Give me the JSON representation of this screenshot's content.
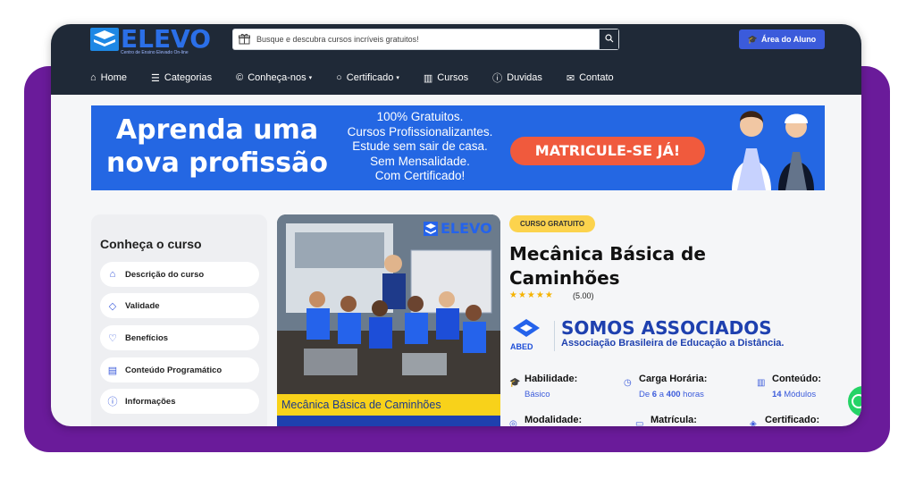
{
  "brand": {
    "name": "ELEVO",
    "tagline": "Centro de Ensino Elevado On-line"
  },
  "header": {
    "search_placeholder": "Busque e descubra cursos incríveis gratuitos!",
    "student_area_label": "Área do Aluno"
  },
  "nav": {
    "items": [
      {
        "label": "Home",
        "icon": "home-icon"
      },
      {
        "label": "Categorias",
        "icon": "menu-icon"
      },
      {
        "label": "Conheça-nos",
        "icon": "copyright-icon"
      },
      {
        "label": "Certificado",
        "icon": "circle-icon"
      },
      {
        "label": "Cursos",
        "icon": "books-icon"
      },
      {
        "label": "Duvidas",
        "icon": "question-icon"
      },
      {
        "label": "Contato",
        "icon": "mail-icon"
      }
    ]
  },
  "banner": {
    "headline": "Aprenda uma nova profissão",
    "lines": [
      "100% Gratuitos.",
      "Cursos Profissionalizantes.",
      "Estude sem sair de casa.",
      "Sem Mensalidade.",
      "Com Certificado!"
    ],
    "cta": "MATRICULE-SE JÁ!"
  },
  "sidebar": {
    "title": "Conheça o curso",
    "items": [
      {
        "label": "Descrição do curso",
        "icon": "gift-icon"
      },
      {
        "label": "Validade",
        "icon": "shield-icon"
      },
      {
        "label": "Benefícios",
        "icon": "heart-icon"
      },
      {
        "label": "Conteúdo Programático",
        "icon": "list-icon"
      },
      {
        "label": "Informações",
        "icon": "info-icon"
      }
    ]
  },
  "course": {
    "badge": "CURSO GRATUITO",
    "title": "Mecânica Básica de Caminhões",
    "image_caption": "Mecânica Básica de Caminhões",
    "image_logo": "ELEVO",
    "rating": "(5.00)",
    "stars": 5
  },
  "association": {
    "logo_text": "ABED",
    "title": "SOMOS ASSOCIADOS",
    "subtitle": "Associação Brasileira de Educação a Distância."
  },
  "details": {
    "habilidade": {
      "label": "Habilidade:",
      "value": "Básico"
    },
    "carga": {
      "label": "Carga Horária:",
      "prefix": "De",
      "min": "6",
      "mid": "a",
      "max": "400",
      "unit": "horas"
    },
    "conteudo": {
      "label": "Conteúdo:",
      "count": "14",
      "unit": "Módulos"
    },
    "modalidade": {
      "label": "Modalidade:"
    },
    "matricula": {
      "label": "Matrícula:"
    },
    "certificado": {
      "label": "Certificado:"
    }
  },
  "colors": {
    "topbar": "#1f2937",
    "accent": "#3b5bdb",
    "banner": "#2467e3",
    "cta": "#f05a3d",
    "badge": "#fcd34d",
    "frame_purple": "#6a1b9a"
  }
}
